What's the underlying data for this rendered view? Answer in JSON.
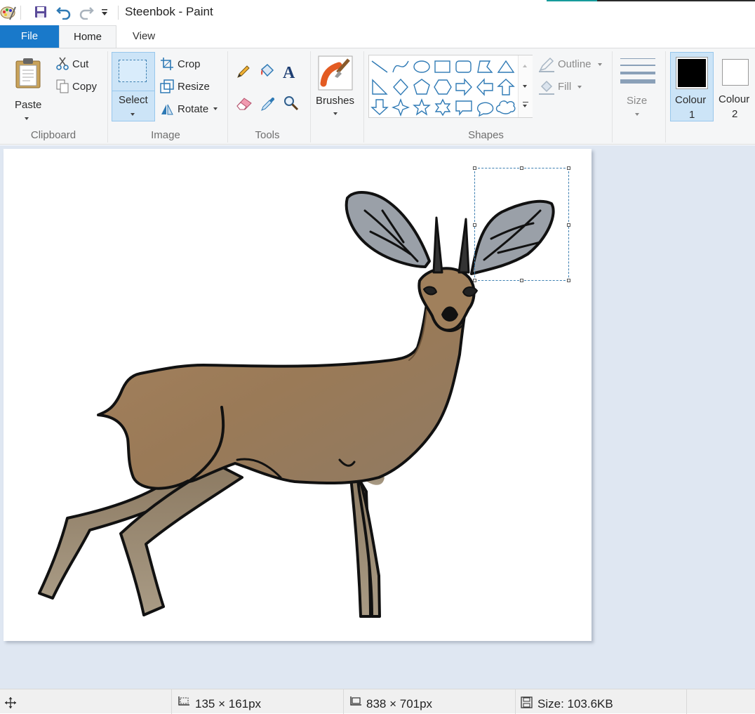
{
  "app": {
    "title": "Steenbok - Paint"
  },
  "tabs": {
    "file": "File",
    "home": "Home",
    "view": "View"
  },
  "clipboard": {
    "paste": "Paste",
    "cut": "Cut",
    "copy": "Copy",
    "group_label": "Clipboard"
  },
  "image": {
    "select": "Select",
    "crop": "Crop",
    "resize": "Resize",
    "rotate": "Rotate",
    "group_label": "Image"
  },
  "tools": {
    "group_label": "Tools"
  },
  "brushes": {
    "label": "Brushes"
  },
  "shapes": {
    "outline": "Outline",
    "fill": "Fill",
    "group_label": "Shapes"
  },
  "size": {
    "label": "Size"
  },
  "colours": {
    "colour1_line1": "Colour",
    "colour1_line2": "1",
    "colour2_line1": "Colour",
    "colour2_line2": "2",
    "colour1_value": "#000000",
    "colour2_value": "#ffffff"
  },
  "status": {
    "selection_size": "135 × 161px",
    "image_size": "838 × 701px",
    "file_size": "Size: 103.6KB"
  },
  "theme": {
    "accent": "#1979ca",
    "selection_bg": "#cce4f7",
    "icon_blue": "#2f7ab5",
    "workspace_bg": "#dfe7f2"
  }
}
